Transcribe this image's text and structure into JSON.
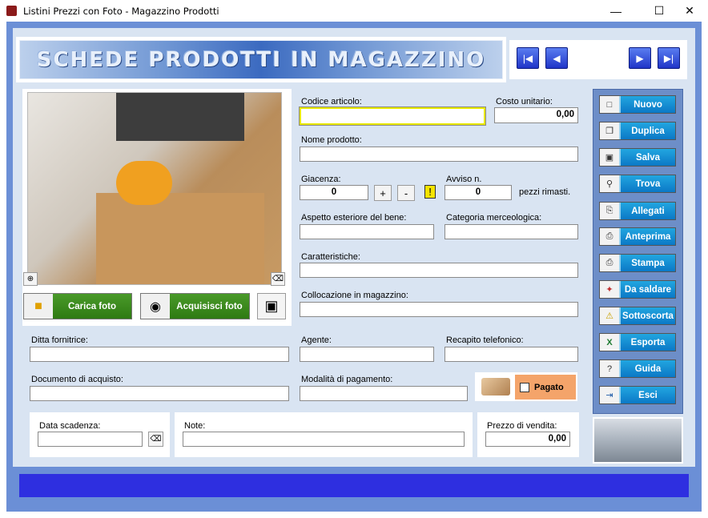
{
  "window": {
    "title": "Listini Prezzi con Foto - Magazzino Prodotti",
    "minimize": "—",
    "maximize": "☐",
    "close": "✕"
  },
  "banner": {
    "text": "SCHEDE PRODOTTI IN MAGAZZINO"
  },
  "nav": {
    "first": "|◀",
    "prev": "◀",
    "next": "▶",
    "last": "▶|"
  },
  "photo": {
    "load_label": "Carica foto",
    "acquire_label": "Acquisisci foto",
    "zoom_icon": "magnifier-icon",
    "erase_icon": "eraser-icon"
  },
  "fields": {
    "codice_label": "Codice articolo:",
    "codice_value": "",
    "costo_label": "Costo unitario:",
    "costo_value": "0,00",
    "nome_label": "Nome prodotto:",
    "giacenza_label": "Giacenza:",
    "giacenza_value": "0",
    "plus": "+",
    "minus": "-",
    "avviso_label": "Avviso n.",
    "avviso_value": "0",
    "pezzi_label": "pezzi rimasti.",
    "aspetto_label": "Aspetto esteriore del bene:",
    "categoria_label": "Categoria merceologica:",
    "caratteristiche_label": "Caratteristiche:",
    "collocazione_label": "Collocazione in magazzino:",
    "ditta_label": "Ditta fornitrice:",
    "agente_label": "Agente:",
    "recapito_label": "Recapito telefonico:",
    "documento_label": "Documento di acquisto:",
    "modalita_label": "Modalità di pagamento:",
    "pagato_label": "Pagato",
    "scadenza_label": "Data scadenza:",
    "note_label": "Note:",
    "prezzo_label": "Prezzo di vendita:",
    "prezzo_value": "0,00"
  },
  "sidebar": {
    "items": [
      {
        "label": "Nuovo",
        "icon": "□"
      },
      {
        "label": "Duplica",
        "icon": "❐"
      },
      {
        "label": "Salva",
        "icon": "▣"
      },
      {
        "label": "Trova",
        "icon": "⚲"
      },
      {
        "label": "Allegati",
        "icon": "⎘"
      },
      {
        "label": "Anteprima",
        "icon": "⎙"
      },
      {
        "label": "Stampa",
        "icon": "⎙"
      },
      {
        "label": "Da saldare",
        "icon": "✦"
      },
      {
        "label": "Sottoscorta",
        "icon": "⚠"
      },
      {
        "label": "Esporta",
        "icon": "X"
      },
      {
        "label": "Guida",
        "icon": "?"
      },
      {
        "label": "Esci",
        "icon": "⇥"
      }
    ]
  }
}
